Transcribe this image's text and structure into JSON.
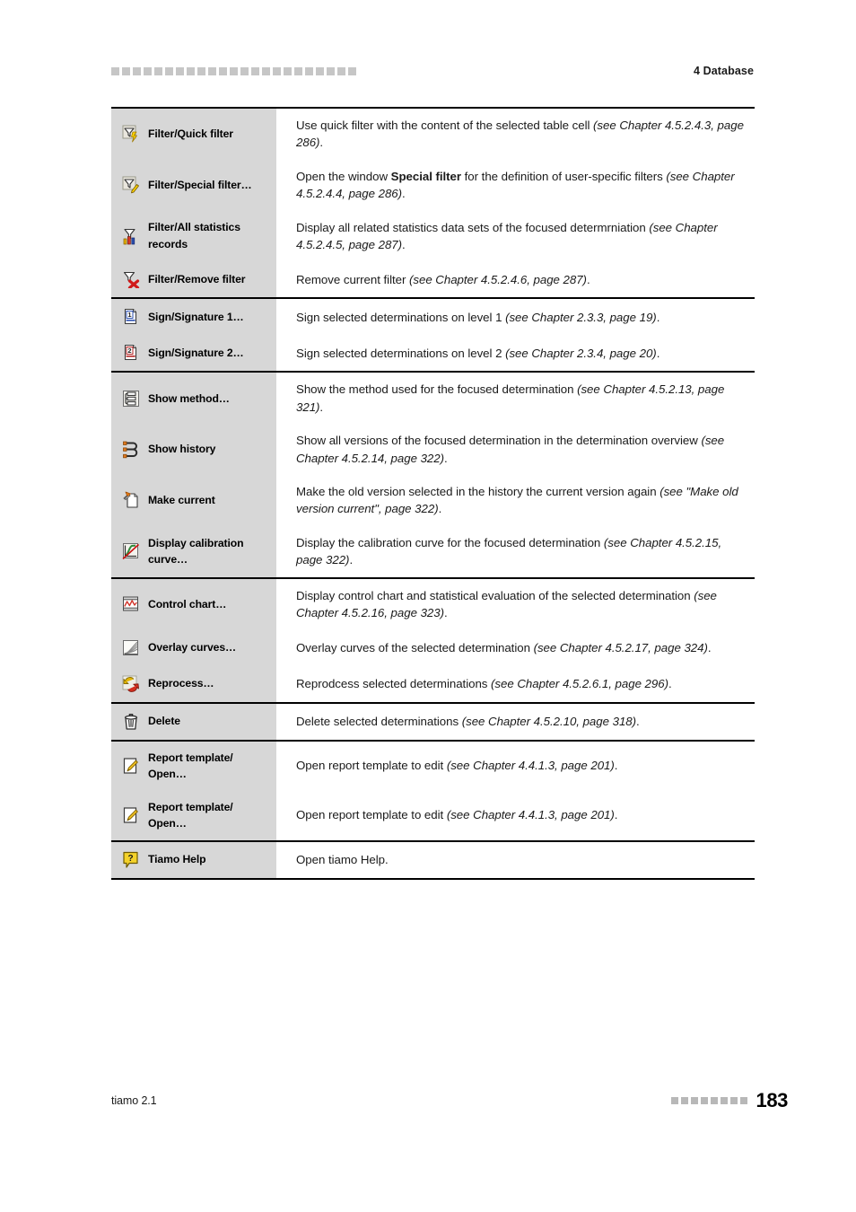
{
  "header": {
    "title": "4 Database",
    "marker_squares": 23
  },
  "footer": {
    "product": "tiamo 2.1",
    "page_number": "183",
    "marker_squares": 8
  },
  "colors": {
    "label_column_bg": "#d7d7d7",
    "rule": "#000000",
    "marker_gray": "#c6c6c6",
    "accent_yellow": "#ffcc00",
    "accent_red": "#cc2222"
  },
  "table": {
    "groups": [
      {
        "rows": [
          {
            "icon": "filter-quick-icon",
            "label": "Filter/Quick filter",
            "desc_plain": "Use quick filter with the content of the selected table cell ",
            "desc_italic": "(see Chapter 4.5.2.4.3, page 286)",
            "desc_tail": "."
          },
          {
            "icon": "filter-special-icon",
            "label": "Filter/Special filter…",
            "desc_plain": "Open the window ",
            "desc_bold": "Special filter",
            "desc_plain2": " for the definition of user-specific filters ",
            "desc_italic": "(see Chapter 4.5.2.4.4, page 286)",
            "desc_tail": "."
          },
          {
            "icon": "filter-statistics-icon",
            "label": "Filter/All statistics records",
            "desc_plain": "Display all related statistics data sets of the focused determrniation ",
            "desc_italic": "(see Chapter 4.5.2.4.5, page 287)",
            "desc_tail": "."
          },
          {
            "icon": "filter-remove-icon",
            "label": "Filter/Remove filter",
            "desc_plain": "Remove current filter ",
            "desc_italic": "(see Chapter 4.5.2.4.6, page 287)",
            "desc_tail": "."
          }
        ]
      },
      {
        "rows": [
          {
            "icon": "signature-1-icon",
            "label": "Sign/Signature 1…",
            "desc_plain": "Sign selected determinations on level 1 ",
            "desc_italic": "(see Chapter 2.3.3, page 19)",
            "desc_tail": "."
          },
          {
            "icon": "signature-2-icon",
            "label": "Sign/Signature 2…",
            "desc_plain": "Sign selected determinations on level 2 ",
            "desc_italic": "(see Chapter 2.3.4, page 20)",
            "desc_tail": "."
          }
        ]
      },
      {
        "rows": [
          {
            "icon": "show-method-icon",
            "label": "Show method…",
            "desc_plain": "Show the method used for the focused determination ",
            "desc_italic": "(see Chapter 4.5.2.13, page 321)",
            "desc_tail": "."
          },
          {
            "icon": "show-history-icon",
            "label": "Show history",
            "desc_plain": "Show all versions of the focused determination in the determination overview ",
            "desc_italic": "(see Chapter 4.5.2.14, page 322)",
            "desc_tail": "."
          },
          {
            "icon": "make-current-icon",
            "label": "Make current",
            "desc_plain": "Make the old version selected in the history the current version again ",
            "desc_italic": "(see \"Make old version current\", page 322)",
            "desc_tail": "."
          },
          {
            "icon": "calibration-curve-icon",
            "label": "Display calibration curve…",
            "desc_plain": "Display the calibration curve for the focused determination ",
            "desc_italic": "(see Chapter 4.5.2.15, page 322)",
            "desc_tail": "."
          }
        ]
      },
      {
        "rows": [
          {
            "icon": "control-chart-icon",
            "label": "Control chart…",
            "desc_plain": "Display control chart and statistical evaluation of the selected determination ",
            "desc_italic": "(see Chapter 4.5.2.16, page 323)",
            "desc_tail": "."
          },
          {
            "icon": "overlay-curves-icon",
            "label": "Overlay curves…",
            "desc_plain": "Overlay curves of the selected determination ",
            "desc_italic": "(see Chapter 4.5.2.17, page 324)",
            "desc_tail": "."
          },
          {
            "icon": "reprocess-icon",
            "label": "Reprocess…",
            "desc_plain": "Reprodcess selected determinations ",
            "desc_italic": "(see Chapter 4.5.2.6.1, page 296)",
            "desc_tail": "."
          }
        ]
      },
      {
        "rows": [
          {
            "icon": "delete-icon",
            "label": "Delete",
            "desc_plain": "Delete selected determinations ",
            "desc_italic": "(see Chapter 4.5.2.10, page 318)",
            "desc_tail": "."
          }
        ]
      },
      {
        "rows": [
          {
            "icon": "report-template-open-icon",
            "label": "Report template/ Open…",
            "desc_plain": "Open report template to edit ",
            "desc_italic": "(see Chapter 4.4.1.3, page 201)",
            "desc_tail": "."
          },
          {
            "icon": "report-template-open-icon",
            "label": "Report template/ Open…",
            "desc_plain": "Open report template to edit ",
            "desc_italic": "(see Chapter 4.4.1.3, page 201)",
            "desc_tail": "."
          }
        ]
      },
      {
        "rows": [
          {
            "icon": "tiamo-help-icon",
            "label": "Tiamo Help",
            "desc_plain": "Open tiamo Help.",
            "desc_italic": "",
            "desc_tail": ""
          }
        ]
      }
    ]
  }
}
